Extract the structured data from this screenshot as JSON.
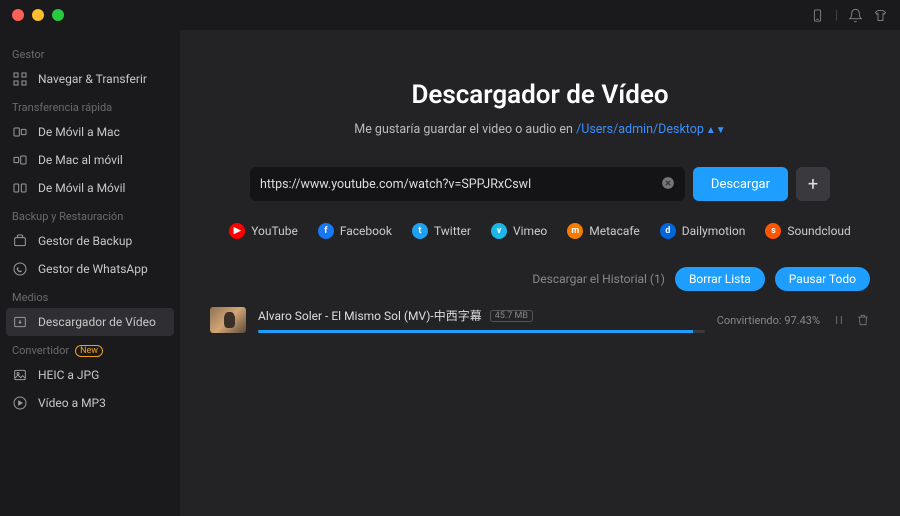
{
  "titlebar": {
    "icons": [
      "phone",
      "bell",
      "shirt"
    ]
  },
  "sidebar": {
    "groups": [
      {
        "label": "Gestor",
        "items": [
          {
            "icon": "grid",
            "label": "Navegar & Transferir"
          }
        ]
      },
      {
        "label": "Transferencia rápida",
        "items": [
          {
            "icon": "phone-to-mac",
            "label": "De Móvil a Mac"
          },
          {
            "icon": "mac-to-phone",
            "label": "De Mac al móvil"
          },
          {
            "icon": "phone-to-phone",
            "label": "De Móvil a Móvil"
          }
        ]
      },
      {
        "label": "Backup y Restauración",
        "items": [
          {
            "icon": "backup",
            "label": "Gestor de Backup"
          },
          {
            "icon": "whatsapp",
            "label": "Gestor de WhatsApp"
          }
        ]
      },
      {
        "label": "Medios",
        "items": [
          {
            "icon": "download",
            "label": "Descargador de Vídeo",
            "active": true
          }
        ]
      },
      {
        "label": "Convertidor",
        "badge": "New",
        "items": [
          {
            "icon": "image",
            "label": "HEIC a JPG"
          },
          {
            "icon": "audio",
            "label": "Vídeo a MP3"
          }
        ]
      }
    ]
  },
  "main": {
    "title": "Descargador de Vídeo",
    "subtitle_prefix": "Me gustaría guardar el video o audio en ",
    "save_path": "/Users/admin/Desktop",
    "url_value": "https://www.youtube.com/watch?v=SPPJRxCswl",
    "download_btn": "Descargar",
    "platforms": [
      {
        "name": "YouTube",
        "color": "#ff0000",
        "letter": "▶"
      },
      {
        "name": "Facebook",
        "color": "#1877f2",
        "letter": "f"
      },
      {
        "name": "Twitter",
        "color": "#1da1f2",
        "letter": "t"
      },
      {
        "name": "Vimeo",
        "color": "#1ab7ea",
        "letter": "v"
      },
      {
        "name": "Metacafe",
        "color": "#f57c00",
        "letter": "m"
      },
      {
        "name": "Dailymotion",
        "color": "#0066dc",
        "letter": "d"
      },
      {
        "name": "Soundcloud",
        "color": "#ff5500",
        "letter": "s"
      }
    ],
    "history_label": "Descargar el Historial (1)",
    "clear_list": "Borrar Lista",
    "pause_all": "Pausar Todo",
    "download": {
      "title": "Alvaro Soler - El Mismo Sol (MV)-中西字幕",
      "size": "45.7 MB",
      "status_prefix": "Convirtiendo:",
      "percent": "97.43%",
      "progress": 97.43
    }
  }
}
